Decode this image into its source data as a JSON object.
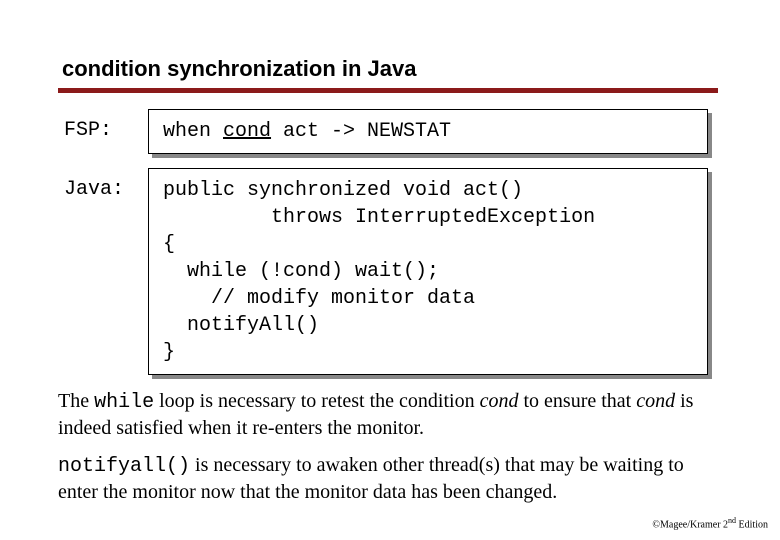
{
  "title": "condition synchronization in Java",
  "fsp": {
    "label": "FSP:",
    "code_prefix": "when ",
    "code_cond": "cond",
    "code_suffix": " act -> NEWSTAT"
  },
  "java": {
    "label": "Java:",
    "lines": {
      "l1": "public synchronized void act()",
      "l2": "         throws InterruptedException",
      "l3": "{",
      "l4": "  while (!cond) wait();",
      "l5": "    // modify monitor data",
      "l6": "  notifyAll()",
      "l7": "}"
    }
  },
  "para1": {
    "t1": "The ",
    "while": "while",
    "t2": " loop is necessary to retest the condition ",
    "cond1": "cond",
    "t3": " to ensure that ",
    "cond2": "cond",
    "t4": " is indeed satisfied when it re-enters the monitor."
  },
  "para2": {
    "notifyall": "notifyall()",
    "t1": " is necessary to awaken other thread(s) that may be waiting to enter the monitor now that the monitor data has been changed."
  },
  "footer": {
    "pre": "©Magee/Kramer ",
    "num": "2",
    "sup": "nd",
    "post": " Edition"
  }
}
